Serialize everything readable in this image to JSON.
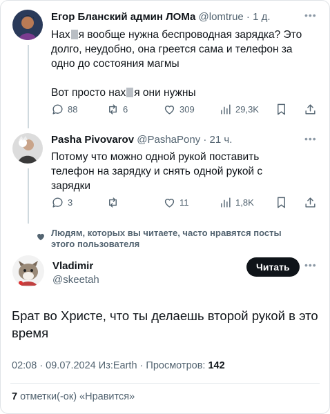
{
  "tweets": [
    {
      "name": "Егор Бланский админ ЛОМа",
      "handle": "@lomtrue",
      "time": "1 д.",
      "text_line1_a": "Нах",
      "text_line1_b": "я вообще нужна беспроводная зарядка? Это",
      "text_line2": "долго, неудобно, она греется сама и телефон за",
      "text_line3": "одно до состояния магмы",
      "text_line4_a": "Вот просто нах",
      "text_line4_b": "я они нужны",
      "replies": "88",
      "reposts": "6",
      "likes": "309",
      "views": "29,3K"
    },
    {
      "name": "Pasha Pivovarov",
      "handle": "@PashaPony",
      "time": "21 ч.",
      "text_line1": "Потому что можно одной рукой поставить",
      "text_line2": "телефон на зарядку и снять одной рукой с",
      "text_line3": "зарядки",
      "replies": "3",
      "reposts": "",
      "likes": "11",
      "views": "1,8K"
    }
  ],
  "context": {
    "line1": "Людям, которых вы читаете, часто нравятся посты",
    "line2": "этого пользователя"
  },
  "main_tweet": {
    "name": "Vladimir",
    "handle": "@skeetah",
    "follow_label": "Читать",
    "text_line1": "Брат во Христе, что ты делаешь второй рукой в это",
    "text_line2": "время",
    "meta_prefix": "02:08 · 09.07.2024 Из:Earth · Просмотров: ",
    "views": "142",
    "likes_count": "7",
    "likes_suffix": " отметки(-ок) «Нравится»"
  },
  "icons": {
    "reply": "reply-icon",
    "repost": "repost-icon",
    "like": "heart-icon",
    "views": "views-icon",
    "bookmark": "bookmark-icon",
    "share": "share-icon",
    "more": "more-icon"
  },
  "colors": {
    "text": "#0f1419",
    "secondary": "#536471",
    "thread_line": "#cfd9de",
    "button": "#0f1419"
  }
}
